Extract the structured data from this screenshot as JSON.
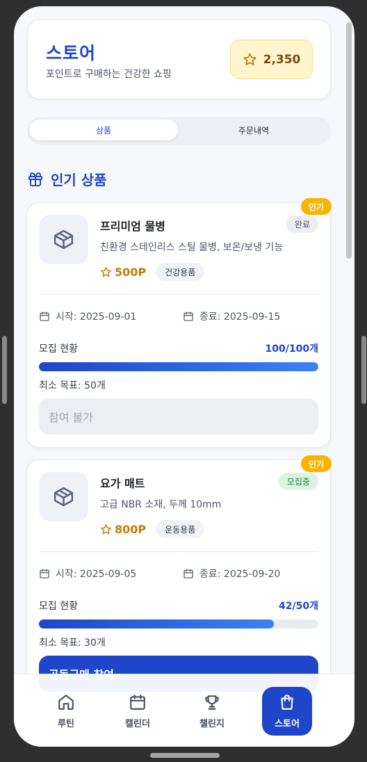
{
  "header": {
    "title": "스토어",
    "subtitle": "포인트로 구매하는 건강한 쇼핑",
    "points": "2,350"
  },
  "tabs": [
    {
      "label": "상품",
      "active": true
    },
    {
      "label": "주문내역",
      "active": false
    }
  ],
  "section": {
    "title": "인기 상품",
    "icon": "gift-icon"
  },
  "products": [
    {
      "badge": "인기",
      "name": "프리미엄 물병",
      "status": "완료",
      "description": "친환경 스테인리스 스틸 물병, 보온/보냉 기능",
      "price": "500P",
      "category": "건강용품",
      "start": "시작: 2025-09-01",
      "end": "종료: 2025-09-15",
      "recruit_label": "모집 현황",
      "recruit_count": "100/100개",
      "progress": 1.0,
      "min_goal": "최소 목표: 50개",
      "button": "참여 불가"
    },
    {
      "badge": "인기",
      "name": "요가 매트",
      "status": "모집중",
      "description": "고급 NBR 소재, 두께 10mm",
      "price": "800P",
      "category": "운동용품",
      "start": "시작: 2025-09-05",
      "end": "종료: 2025-09-20",
      "recruit_label": "모집 현황",
      "recruit_count": "42/50개",
      "progress": 0.84,
      "min_goal": "최소 목표: 30개",
      "button": "공동구매 참여"
    }
  ],
  "nav": [
    {
      "label": "루틴",
      "icon": "home-icon"
    },
    {
      "label": "캘린더",
      "icon": "calendar-icon"
    },
    {
      "label": "챌린지",
      "icon": "trophy-icon"
    },
    {
      "label": "스토어",
      "icon": "shopping-bag-icon",
      "active": true
    }
  ],
  "colors": {
    "brand": "#1f45c8",
    "points_bg": "#fff6cf",
    "badge": "#f8b400",
    "status_open_bg": "#d9f5e2",
    "price": "#c27a08"
  }
}
